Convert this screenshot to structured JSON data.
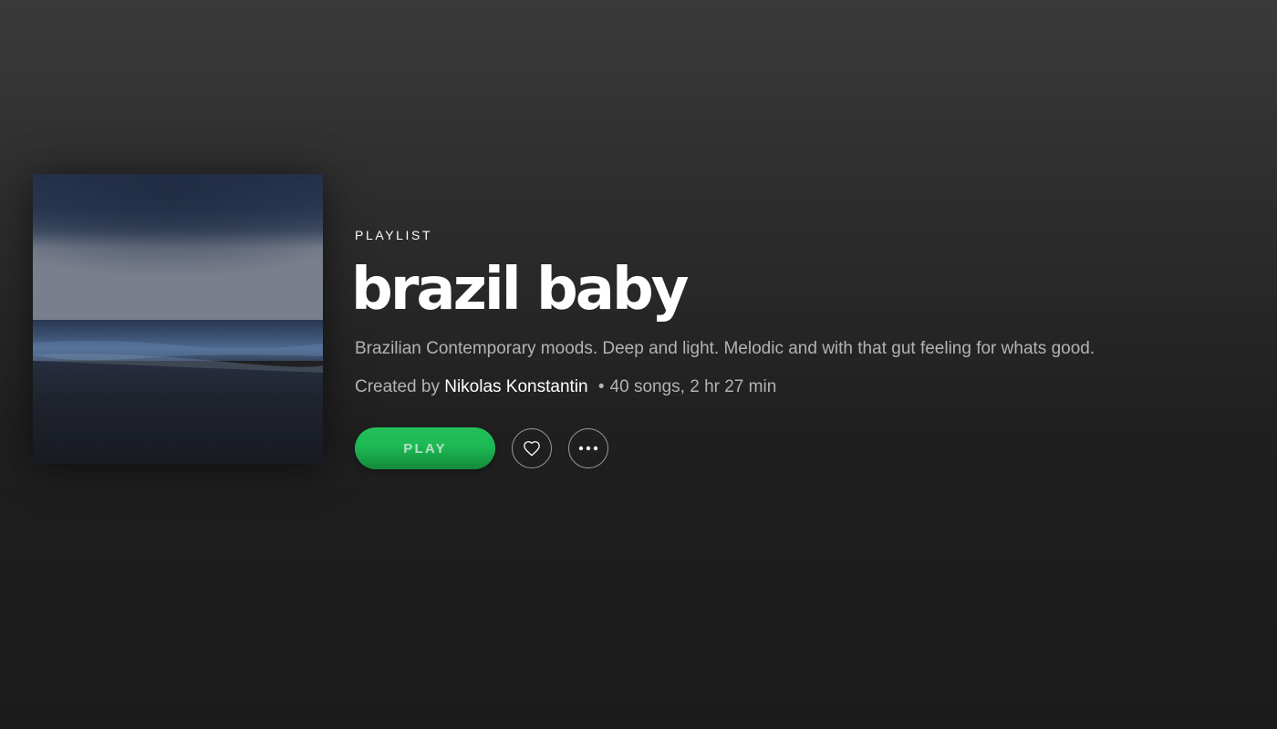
{
  "playlist": {
    "type_label": "PLAYLIST",
    "title": "brazil baby",
    "description": "Brazilian Contemporary moods. Deep and light. Melodic and with that gut feeling for whats good.",
    "created_by_prefix": "Created by",
    "owner": "Nikolas Konstantin",
    "separator": "•",
    "stats": "40 songs, 2 hr 27 min"
  },
  "actions": {
    "play_label": "PLAY",
    "like_icon": "heart-icon",
    "more_icon": "more-dots-icon"
  },
  "colors": {
    "accent": "#1db954",
    "text_secondary": "#b3b3b3",
    "background": "#1b1b1b"
  }
}
